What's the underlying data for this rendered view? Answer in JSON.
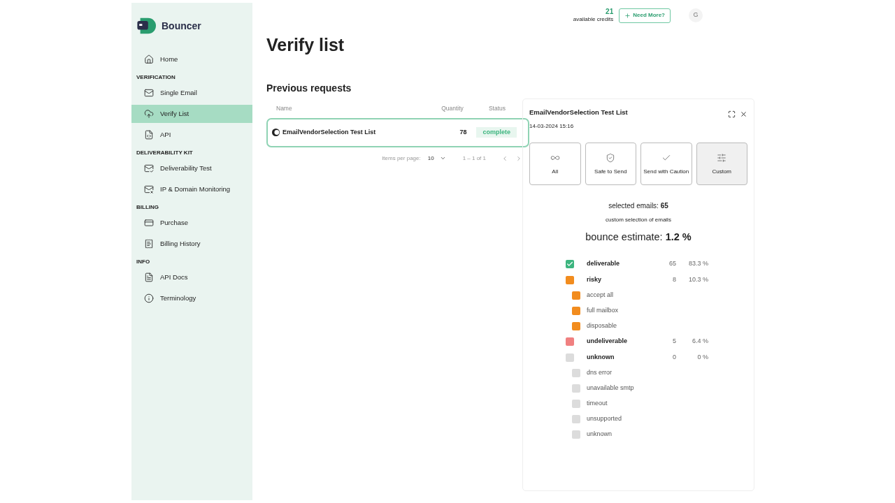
{
  "brand": {
    "name": "Bouncer"
  },
  "sidebar": {
    "sections": [
      {
        "items": [
          {
            "label": "Home",
            "selected": false
          }
        ]
      },
      {
        "heading": "VERIFICATION",
        "items": [
          {
            "label": "Single Email",
            "selected": false
          },
          {
            "label": "Verify List",
            "selected": true
          },
          {
            "label": "API",
            "selected": false
          }
        ]
      },
      {
        "heading": "DELIVERABILITY KIT",
        "items": [
          {
            "label": "Deliverability Test",
            "selected": false
          },
          {
            "label": "IP & Domain Monitoring",
            "selected": false
          }
        ]
      },
      {
        "heading": "BILLING",
        "items": [
          {
            "label": "Purchase",
            "selected": false
          },
          {
            "label": "Billing History",
            "selected": false
          }
        ]
      },
      {
        "heading": "INFO",
        "items": [
          {
            "label": "API Docs",
            "selected": false
          },
          {
            "label": "Terminology",
            "selected": false
          }
        ]
      }
    ]
  },
  "header": {
    "credits": "21",
    "credits_label": "available credits",
    "need_more": "Need More?",
    "avatar": "G"
  },
  "page_title": "Verify list",
  "section_title": "Previous requests",
  "table": {
    "columns": [
      "Name",
      "Quantity",
      "Status"
    ],
    "rows": [
      {
        "name": "EmailVendorSelection Test List",
        "quantity": "78",
        "status": "complete",
        "selected": true
      }
    ]
  },
  "pagination": {
    "items_per_page_label": "Items per page:",
    "items_per_page": "10",
    "range": "1 – 1 of 1"
  },
  "panel": {
    "title": "EmailVendorSelection Test List",
    "date": "14-03-2024 15:16",
    "filters": [
      {
        "label": "All",
        "selected": false
      },
      {
        "label": "Safe to Send",
        "selected": false
      },
      {
        "label": "Send with Caution",
        "selected": false
      },
      {
        "label": "Custom",
        "selected": true
      }
    ],
    "selected_emails": "selected emails: **65**",
    "selection_note": "custom selection of emails",
    "bounce_estimate": "bounce estimate: **1.2 %**",
    "categories": [
      {
        "label": "deliverable",
        "count": "65",
        "percent": "83.3 %",
        "color": "#3db57f",
        "checked": true
      },
      {
        "label": "risky",
        "count": "8",
        "percent": "10.3 %",
        "color": "#f28c1e",
        "checked": false,
        "children": [
          {
            "label": "accept all",
            "color": "#f28c1e",
            "checked": false
          },
          {
            "label": "full mailbox",
            "color": "#f28c1e",
            "checked": false
          },
          {
            "label": "disposable",
            "color": "#f28c1e",
            "checked": false
          }
        ]
      },
      {
        "label": "undeliverable",
        "count": "5",
        "percent": "6.4 %",
        "color": "#f08080",
        "checked": false
      },
      {
        "label": "unknown",
        "count": "0",
        "percent": "0 %",
        "color": "#dcdcdc",
        "checked": false,
        "children": [
          {
            "label": "dns error",
            "color": "#dcdcdc",
            "checked": false
          },
          {
            "label": "unavailable smtp",
            "color": "#dcdcdc",
            "checked": false
          },
          {
            "label": "timeout",
            "color": "#dcdcdc",
            "checked": false
          },
          {
            "label": "unsupported",
            "color": "#dcdcdc",
            "checked": false
          },
          {
            "label": "unknown",
            "color": "#dcdcdc",
            "checked": false
          }
        ]
      }
    ]
  }
}
